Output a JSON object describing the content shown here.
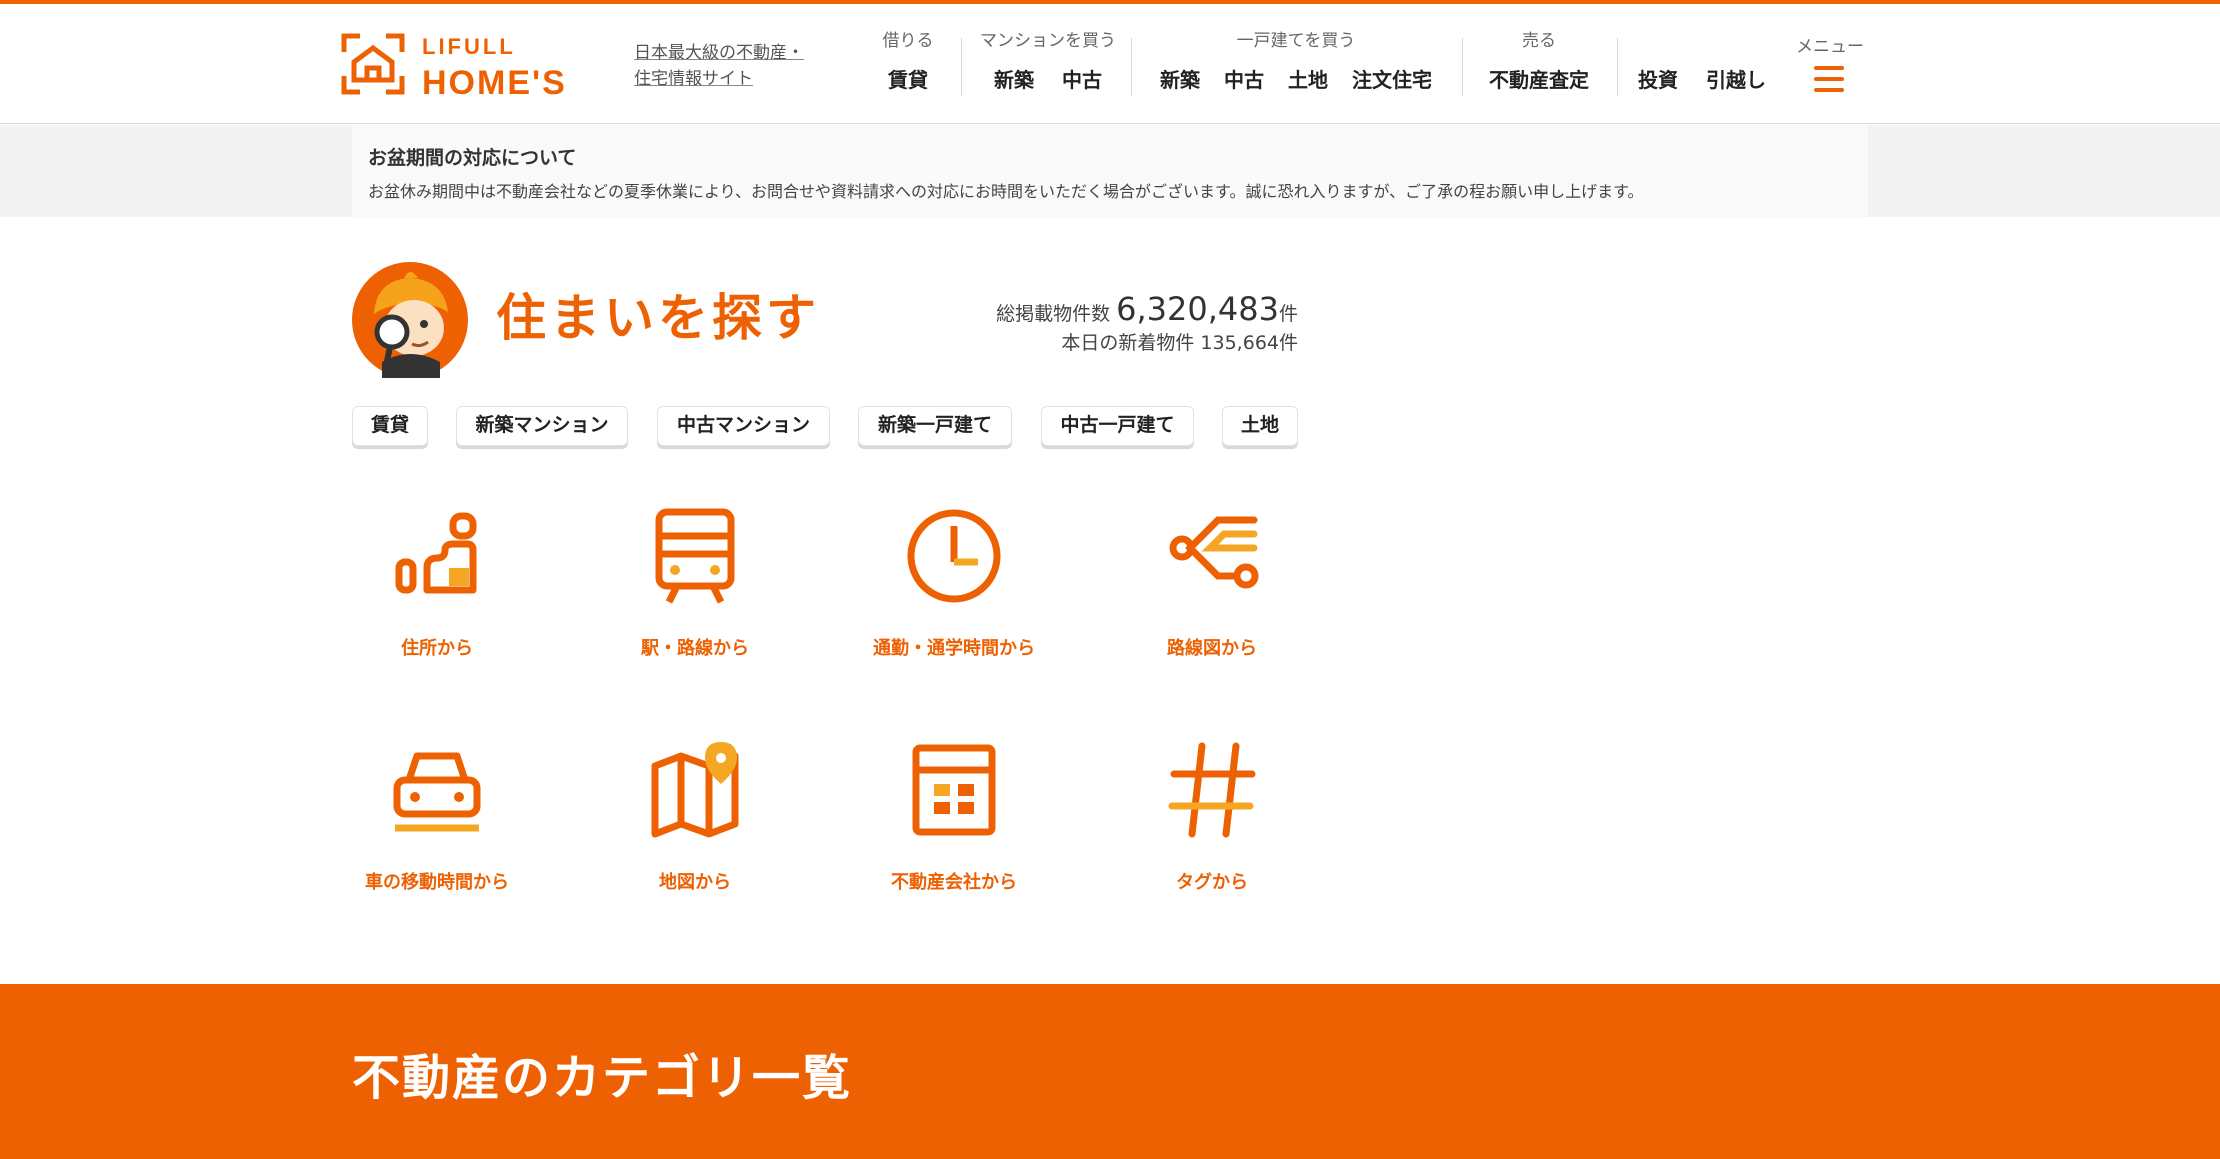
{
  "header": {
    "logo_top": "LIFULL",
    "logo_bottom": "HOME'S",
    "tagline_1": "日本最大級の不動産・",
    "tagline_2": "住宅情報サイト",
    "nav": [
      {
        "category": "借りる",
        "links": [
          "賃貸"
        ]
      },
      {
        "category": "マンションを買う",
        "links": [
          "新築",
          "中古"
        ]
      },
      {
        "category": "一戸建てを買う",
        "links": [
          "新築",
          "中古",
          "土地",
          "注文住宅"
        ]
      },
      {
        "category": "売る",
        "links": [
          "不動産査定"
        ]
      },
      {
        "category": "",
        "links": [
          "投資",
          "引越し"
        ]
      }
    ],
    "menu_label": "メニュー"
  },
  "notice": {
    "title": "お盆期間の対応について",
    "body": "お盆休み期間中は不動産会社などの夏季休業により、お問合せや資料請求への対応にお時間をいただく場合がございます。誠に恐れ入りますが、ご了承の程お願い申し上げます。"
  },
  "search": {
    "title": "住まいを探す",
    "total_label": "総掲載物件数",
    "total_count": "6,320,483",
    "unit": "件",
    "new_label": "本日の新着物件",
    "new_count": "135,664件"
  },
  "tabs": [
    "賃貸",
    "新築マンション",
    "中古マンション",
    "新築一戸建て",
    "中古一戸建て",
    "土地"
  ],
  "methods": [
    {
      "label": "住所から",
      "icon": "address-icon"
    },
    {
      "label": "駅・路線から",
      "icon": "train-icon"
    },
    {
      "label": "通勤・通学時間から",
      "icon": "clock-icon"
    },
    {
      "label": "路線図から",
      "icon": "route-map-icon"
    },
    {
      "label": "車の移動時間から",
      "icon": "car-icon"
    },
    {
      "label": "地図から",
      "icon": "map-icon"
    },
    {
      "label": "不動産会社から",
      "icon": "company-icon"
    },
    {
      "label": "タグから",
      "icon": "hashtag-icon"
    }
  ],
  "category_section": {
    "title": "不動産のカテゴリ一覧"
  },
  "colors": {
    "accent": "#ed6103",
    "accent_light": "#f5a623",
    "notice_bg": "#f3f3f4"
  }
}
